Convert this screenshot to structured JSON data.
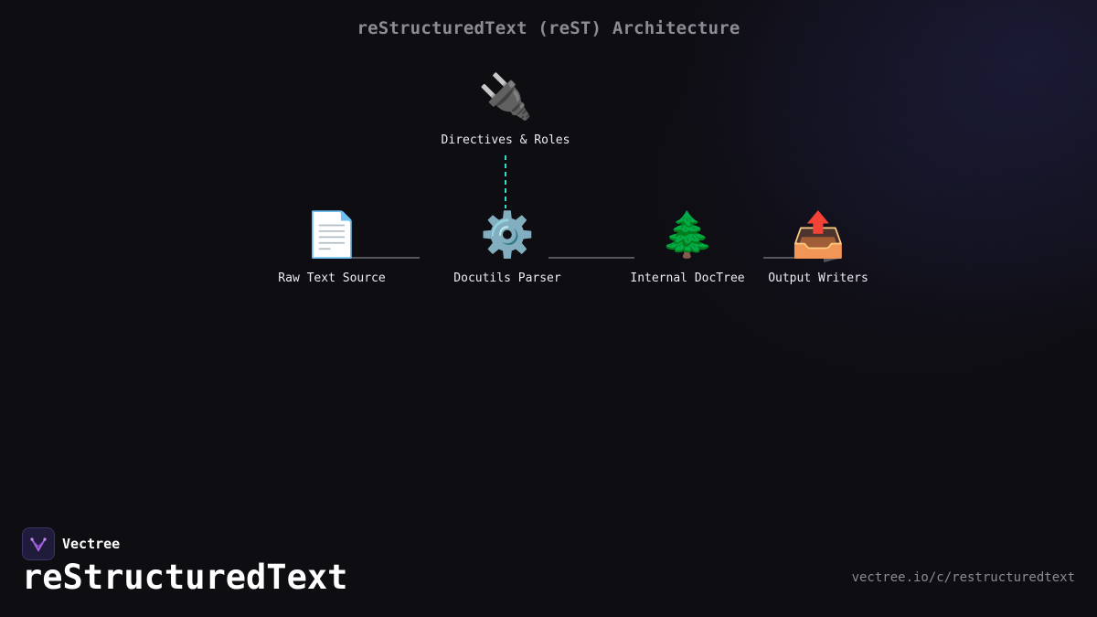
{
  "diagram": {
    "title": "reStructuredText (reST) Architecture",
    "nodes": [
      {
        "id": "directives",
        "icon": "🔌",
        "icon_name": "plug-icon",
        "label": "Directives & Roles"
      },
      {
        "id": "raw-text",
        "icon": "📄",
        "icon_name": "document-icon",
        "label": "Raw Text Source"
      },
      {
        "id": "parser",
        "icon": "⚙️",
        "icon_name": "gear-icon",
        "label": "Docutils Parser"
      },
      {
        "id": "doctree",
        "icon": "🌲",
        "icon_name": "tree-icon",
        "label": "Internal DocTree"
      },
      {
        "id": "writers",
        "icon": "📤",
        "icon_name": "outbox-icon",
        "label": "Output Writers"
      }
    ],
    "edges": [
      {
        "from": "raw-text",
        "to": "parser",
        "style": "solid"
      },
      {
        "from": "parser",
        "to": "doctree",
        "style": "solid"
      },
      {
        "from": "doctree",
        "to": "writers",
        "style": "solid-arrow"
      },
      {
        "from": "directives",
        "to": "parser",
        "style": "dashed"
      }
    ],
    "colors": {
      "edge": "#55555c",
      "dashed_edge": "#2de0c8"
    }
  },
  "brand": {
    "name": "Vectree",
    "logo_icon": "vectree-logo-icon",
    "logo_color": "#b06ae0"
  },
  "page": {
    "heading": "reStructuredText",
    "url": "vectree.io/c/restructuredtext"
  }
}
